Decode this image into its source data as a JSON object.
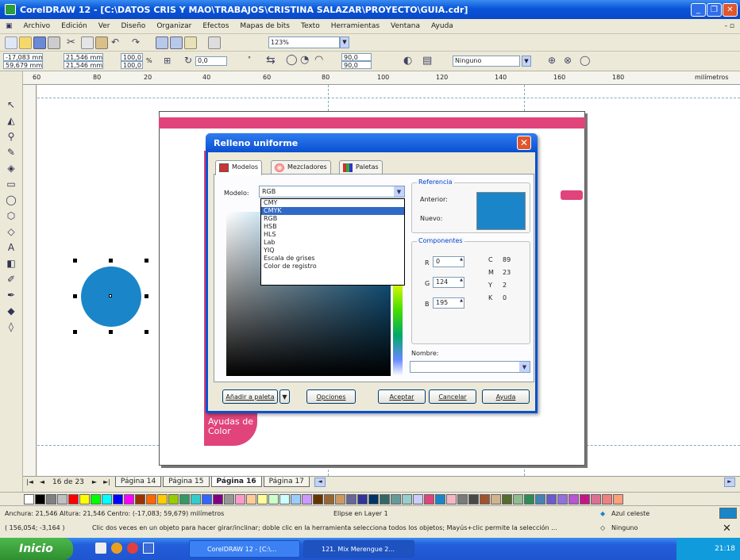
{
  "app": {
    "title": "CorelDRAW 12 - [C:\\DATOS CRIS Y MAO\\TRABAJOS\\CRISTINA SALAZAR\\PROYECTO\\GUIA.cdr]",
    "zoom": "123%",
    "window_controls": {
      "minimize": "_",
      "restore": "❐",
      "close": "✕"
    }
  },
  "menu": [
    "Archivo",
    "Edición",
    "Ver",
    "Diseño",
    "Organizar",
    "Efectos",
    "Mapas de bits",
    "Texto",
    "Herramientas",
    "Ventana",
    "Ayuda"
  ],
  "menu_right": "- ▫",
  "propbar": {
    "x": "-17,083 mm",
    "y": "59,679 mm",
    "w": "21,546 mm",
    "h": "21,546 mm",
    "sx": "100,0",
    "sy": "100,0",
    "pct": "%",
    "rot": "0,0",
    "deg": "°",
    "a1": "90,0",
    "a2": "90,0",
    "outline": "Ninguno"
  },
  "ruler_ticks": [
    "60",
    "80",
    "20",
    "40",
    "60",
    "80",
    "100",
    "120",
    "140",
    "160",
    "180",
    "milímetros"
  ],
  "dialog": {
    "title": "Relleno uniforme",
    "close": "✕",
    "tabs": [
      "Modelos",
      "Mezcladores",
      "Paletas"
    ],
    "model_label": "Modelo:",
    "model_value": "RGB",
    "model_options": [
      "CMY",
      "CMYK",
      "RGB",
      "HSB",
      "HLS",
      "Lab",
      "YIQ",
      "Escala de grises",
      "Color de registro"
    ],
    "selected_option": "CMYK",
    "reference_label": "Referencia",
    "old_label": "Anterior:",
    "new_label": "Nuevo:",
    "components_label": "Componentes",
    "r_label": "R",
    "r_value": "0",
    "g_label": "G",
    "g_value": "124",
    "b_label": "B",
    "b_value": "195",
    "c_label": "C",
    "c_value": "89",
    "m_label": "M",
    "m_value": "23",
    "y_label": "Y",
    "y_value": "2",
    "k_label": "K",
    "k_value": "0",
    "name_label": "Nombre:",
    "buttons": {
      "add": "Añadir a paleta",
      "options": "Opciones",
      "accept": "Aceptar",
      "cancel": "Cancelar",
      "help": "Ayuda"
    }
  },
  "artwork": {
    "ayudas": "Ayudas de",
    "color": "Color"
  },
  "pages": {
    "counter": "16 de 23",
    "tabs": [
      "Página 14",
      "Página 15",
      "Página 16",
      "Página 17"
    ],
    "active": "Página 16"
  },
  "palette_colors": [
    "#ffffff",
    "#000000",
    "#808080",
    "#c0c0c0",
    "#ff0000",
    "#ffff00",
    "#00ff00",
    "#00ffff",
    "#0000ff",
    "#ff00ff",
    "#993300",
    "#ff6600",
    "#ffcc00",
    "#99cc00",
    "#339966",
    "#33cccc",
    "#3366ff",
    "#800080",
    "#969696",
    "#ff99cc",
    "#ffcc99",
    "#ffff99",
    "#ccffcc",
    "#ccffff",
    "#99ccff",
    "#cc99ff",
    "#663300",
    "#996633",
    "#cc9966",
    "#666699",
    "#333399",
    "#003366",
    "#336666",
    "#669999",
    "#99cccc",
    "#ccccff",
    "#e0447a",
    "#1a86c9",
    "#f4b6c2",
    "#7a7a7a",
    "#4a4a4a",
    "#a0522d",
    "#d2b48c",
    "#556b2f",
    "#8fbc8f",
    "#2e8b57",
    "#4682b4",
    "#6a5acd",
    "#9370db",
    "#ba55d3",
    "#c71585",
    "#db7093",
    "#f08080",
    "#ffa07a"
  ],
  "status": {
    "line1": "Anchura: 21,546 Altura: 21,546 Centro: (-17,083; 59,679) milímetros",
    "layer": "Elipse en Layer 1",
    "fill": "Azul celeste",
    "line2_coords": "( 156,054; -3,164 )",
    "line2_hint": "Clic dos veces en un objeto para hacer girar/inclinar; doble clic en la herramienta selecciona todos los objetos; Mayús+clic permite la selección ...",
    "outline": "Ninguno"
  },
  "taskbar": {
    "start": "Inicio",
    "items": [
      "CorelDRAW 12 - [C:\\...",
      "121. Mix Merengue 2..."
    ],
    "clock": "21:18"
  }
}
